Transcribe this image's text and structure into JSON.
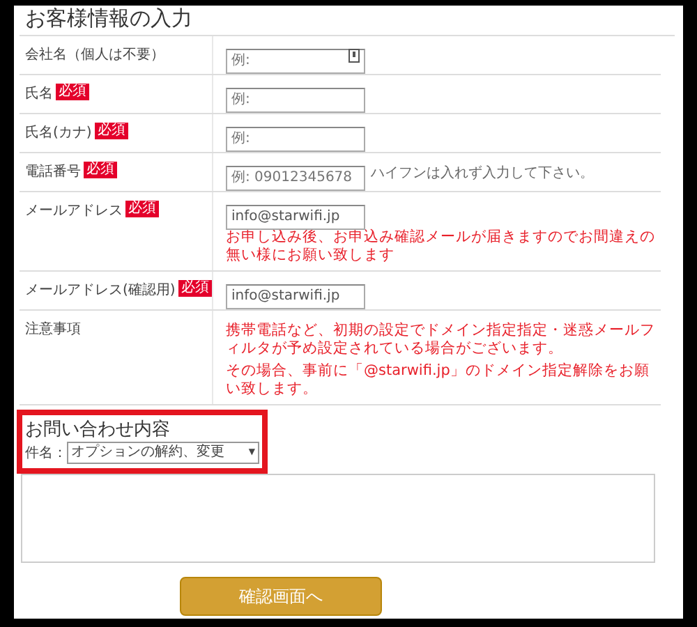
{
  "section_title": "お客様情報の入力",
  "rows": [
    {
      "kind": "input",
      "label": "会社名（個人は不要）",
      "placeholder": "例:",
      "autofill_icon": true
    },
    {
      "kind": "input",
      "label": "氏名",
      "badge": "必須",
      "placeholder": "例:"
    },
    {
      "kind": "input",
      "label": "氏名(カナ)",
      "badge": "必須",
      "placeholder": "例:"
    },
    {
      "kind": "input",
      "label": "電話番号",
      "badge": "必須",
      "placeholder": "例: 09012345678",
      "hint": "ハイフンは入れず入力して下さい。"
    },
    {
      "kind": "input",
      "label": "メールアドレス",
      "badge": "必須",
      "value": "info@starwifi.jp",
      "warning": "お申し込み後、お申込み確認メールが届きますのでお間違えの無い様にお願い致します"
    },
    {
      "kind": "input",
      "label": "メールアドレス(確認用)",
      "badge": "必須",
      "value": "info@starwifi.jp"
    },
    {
      "kind": "note",
      "label": "注意事項",
      "lines": [
        "携帯電話など、初期の設定でドメイン指定指定・迷惑メールフィルタが予め設定されている場合がございます。",
        "その場合、事前に「@starwifi.jp」のドメイン指定解除をお願い致します。"
      ]
    }
  ],
  "inquiry": {
    "title": "お問い合わせ内容",
    "subject_label": "件名：",
    "subject_value": "オプションの解約、変更",
    "caret": "▼"
  },
  "submit_button": "確認画面へ"
}
